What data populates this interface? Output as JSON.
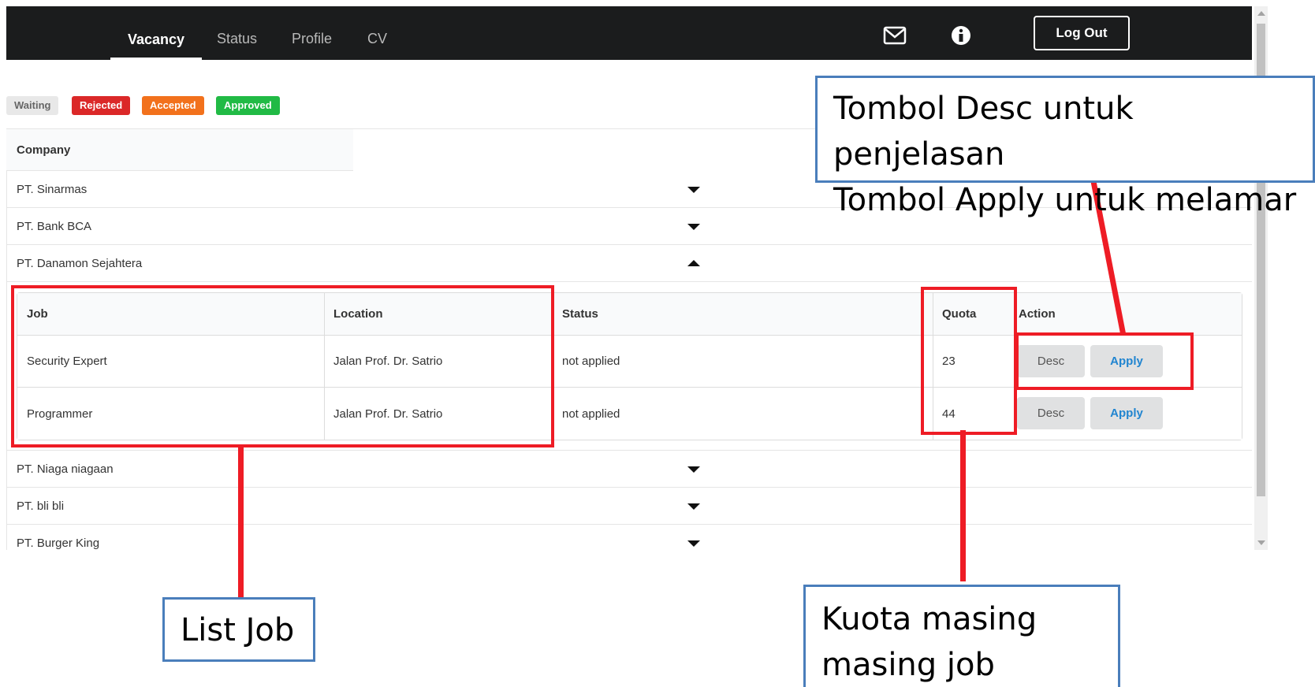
{
  "navbar": {
    "tabs": [
      {
        "label": "Vacancy",
        "active": true
      },
      {
        "label": "Status",
        "active": false
      },
      {
        "label": "Profile",
        "active": false
      },
      {
        "label": "CV",
        "active": false
      }
    ],
    "icons": [
      "envelope-icon",
      "info-icon"
    ],
    "logout_label": "Log Out"
  },
  "legend": [
    {
      "label": "Waiting",
      "color": "#e8e8e8",
      "text_color": "#666666"
    },
    {
      "label": "Rejected",
      "color": "#db2828",
      "text_color": "#ffffff"
    },
    {
      "label": "Accepted",
      "color": "#f2711c",
      "text_color": "#ffffff"
    },
    {
      "label": "Approved",
      "color": "#21ba45",
      "text_color": "#ffffff"
    }
  ],
  "company_header": "Company",
  "companies": [
    {
      "name": "PT. Sinarmas",
      "expanded": false
    },
    {
      "name": "PT. Bank BCA",
      "expanded": false
    },
    {
      "name": "PT. Danamon Sejahtera",
      "expanded": true
    },
    {
      "name": "PT. Niaga niagaan",
      "expanded": false
    },
    {
      "name": "PT. bli bli",
      "expanded": false
    },
    {
      "name": "PT. Burger King",
      "expanded": false
    }
  ],
  "job_table": {
    "headers": [
      "Job",
      "Location",
      "Status",
      "Quota",
      "Action"
    ],
    "rows": [
      {
        "job": "Security Expert",
        "location": "Jalan Prof. Dr. Satrio",
        "status": "not applied",
        "quota": "23",
        "desc_label": "Desc",
        "apply_label": "Apply"
      },
      {
        "job": "Programmer",
        "location": "Jalan Prof. Dr. Satrio",
        "status": "not applied",
        "quota": "44",
        "desc_label": "Desc",
        "apply_label": "Apply"
      }
    ]
  },
  "annotations": {
    "buttons_note_line1": "Tombol Desc untuk penjelasan",
    "buttons_note_line2": "Tombol Apply untuk melamar",
    "list_job": "List Job",
    "quota_line1": "Kuota masing",
    "quota_line2": "masing job"
  },
  "colors": {
    "navbar_bg": "#1b1c1d",
    "annotation_red": "#ee1c25",
    "callout_border": "#4a7ebb",
    "apply_blue": "#2185d0"
  }
}
